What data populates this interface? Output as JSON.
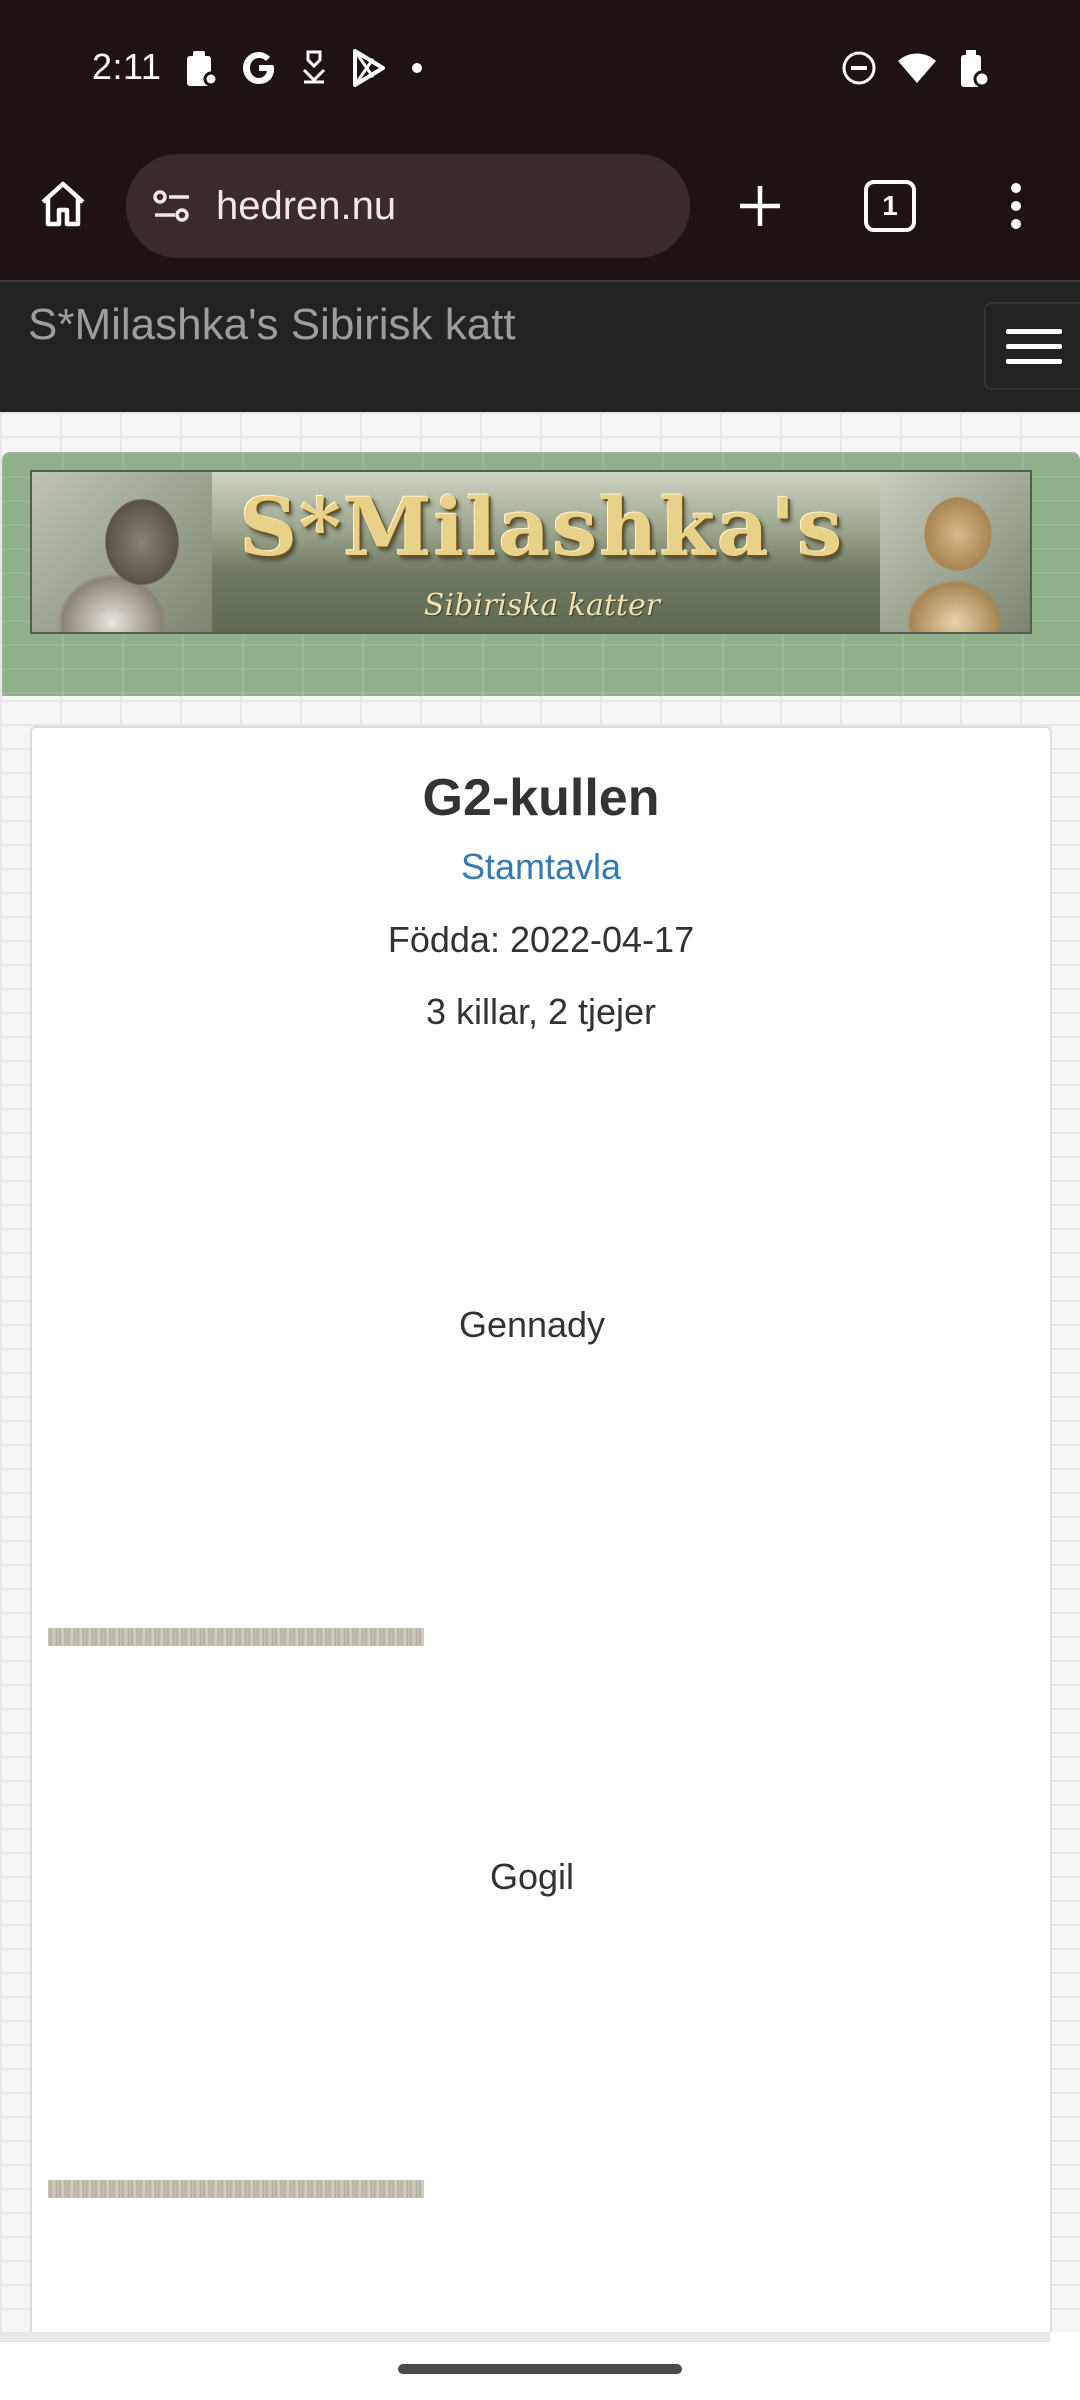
{
  "status_bar": {
    "time": "2:11",
    "left_icons": [
      "clipboard-icon",
      "google-g-icon",
      "download-arrow-icon",
      "play-store-icon",
      "dot-icon"
    ],
    "right_icons": [
      "do-not-disturb-icon",
      "wifi-icon",
      "battery-saver-icon"
    ]
  },
  "browser": {
    "url": "hedren.nu",
    "tab_count": "1"
  },
  "site": {
    "brand": "S*Milashka's Sibirisk katt",
    "banner_title": "S*Milashka's",
    "banner_subtitle": "Sibiriska katter"
  },
  "litter": {
    "title": "G2-kullen",
    "pedigree_link": "Stamtavla",
    "born": "Födda: 2022-04-17",
    "summary": "3 killar, 2 tjejer",
    "kittens": [
      {
        "name": "Gennady"
      },
      {
        "name": "Gogil"
      }
    ]
  },
  "colors": {
    "browser_bar": "#1f1213",
    "omnibox": "#3b2a2a",
    "site_navbar": "#222222",
    "header_green": "#8fb08a",
    "link": "#337ab7"
  }
}
